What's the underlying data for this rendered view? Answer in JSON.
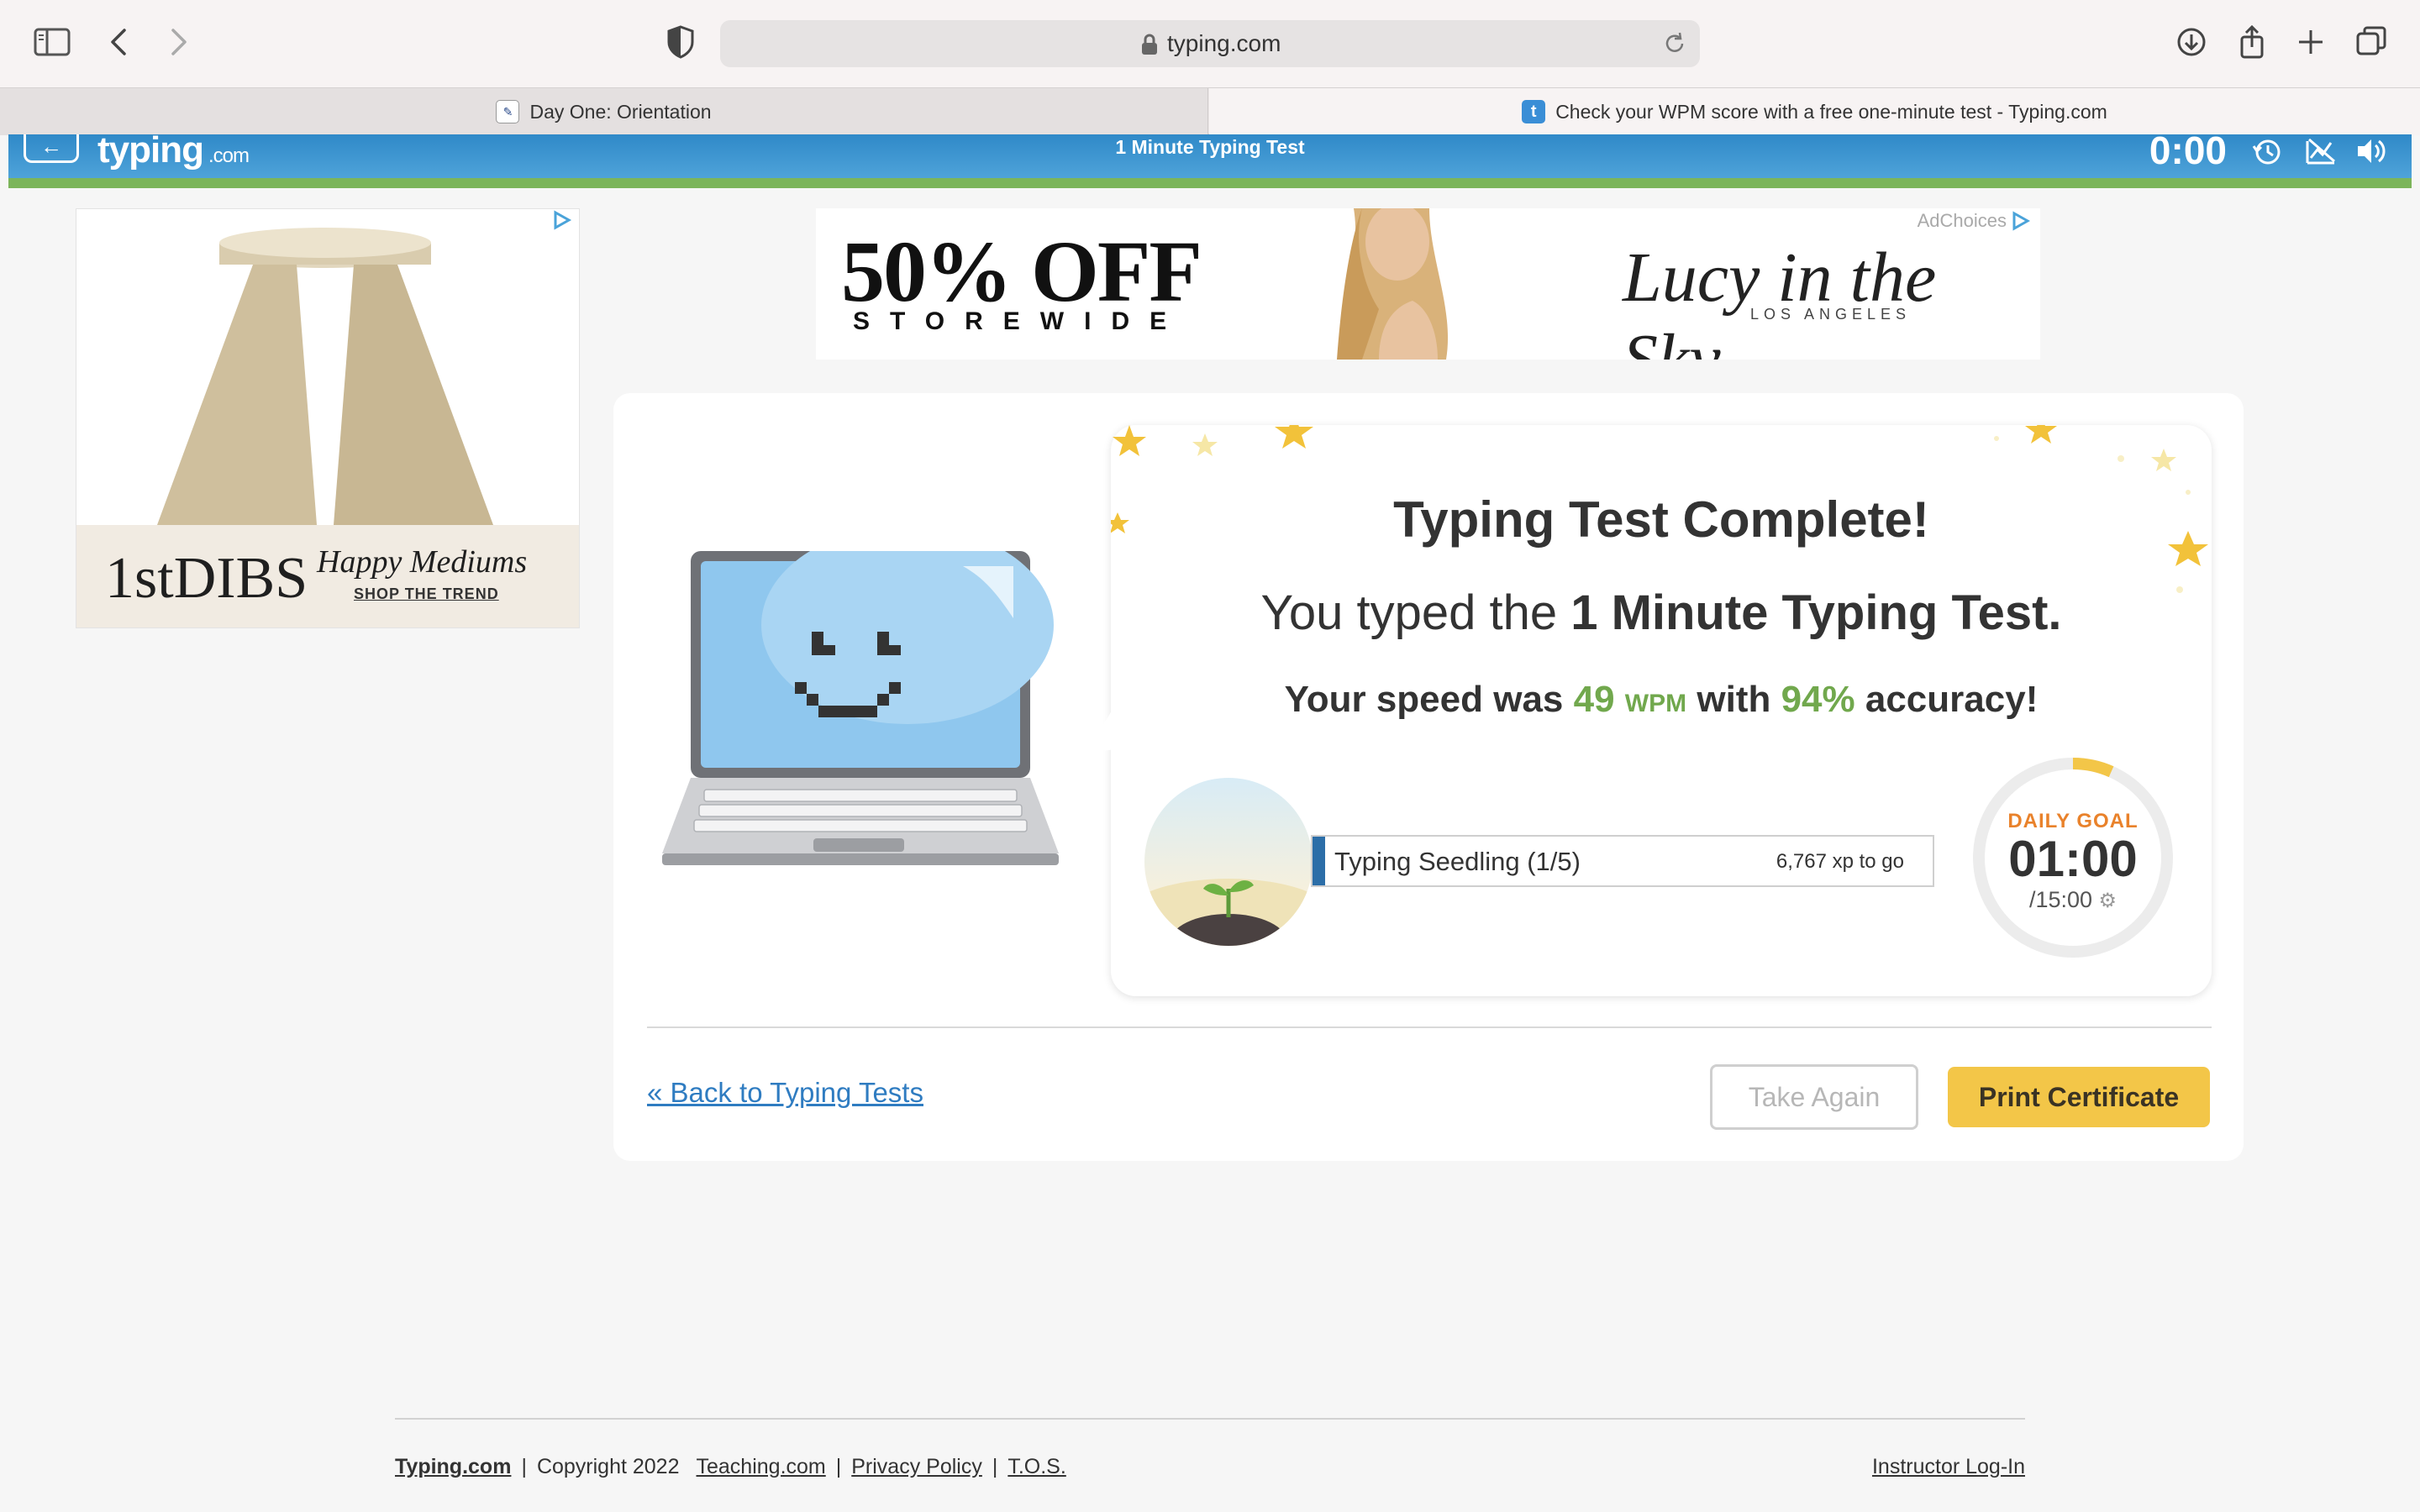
{
  "browser": {
    "url": "typing.com",
    "tabs": [
      {
        "title": "Day One: Orientation"
      },
      {
        "title": "Check your WPM score with a free one-minute test - Typing.com"
      }
    ]
  },
  "header": {
    "logo": "typing",
    "logo_suffix": ".com",
    "title": "1 Minute Typing Test",
    "timer": "0:00",
    "back_arrow": "←"
  },
  "ads": {
    "left": {
      "brand": "1stDIBS",
      "tagline": "Happy Mediums",
      "cta": "SHOP THE TREND"
    },
    "top": {
      "headline": "50% OFF",
      "subline": "STOREWIDE",
      "brand": "Lucy in the Sky",
      "brand_sub": "LOS ANGELES",
      "adchoices": "AdChoices"
    }
  },
  "result": {
    "title": "Typing Test Complete!",
    "typed_prefix": "You typed the ",
    "test_name": "1 Minute Typing Test.",
    "speed_prefix": "Your speed was ",
    "wpm_value": "49",
    "wpm_unit": "WPM",
    "speed_mid": " with ",
    "accuracy": "94%",
    "speed_suffix": " accuracy!"
  },
  "progress": {
    "level_label": "Typing Seedling (1/5)",
    "xp_to_go": "6,767 xp to go",
    "fill_fraction": 0.02
  },
  "daily_goal": {
    "label": "DAILY GOAL",
    "time": "01:00",
    "total": "/15:00",
    "fraction": 0.0667
  },
  "actions": {
    "back_link": "« Back to Typing Tests",
    "take_again": "Take Again",
    "print_certificate": "Print Certificate"
  },
  "footer": {
    "typing_link": "Typing.com",
    "copyright": "Copyright 2022",
    "teaching_link": "Teaching.com",
    "privacy_link": "Privacy Policy",
    "tos_link": "T.O.S.",
    "instructor_link": "Instructor Log-In"
  },
  "colors": {
    "accent_green": "#71a84d",
    "header_blue": "#2f89c8",
    "button_yellow": "#f3c648",
    "link_blue": "#2f7cc1",
    "goal_orange": "#e9822b"
  }
}
